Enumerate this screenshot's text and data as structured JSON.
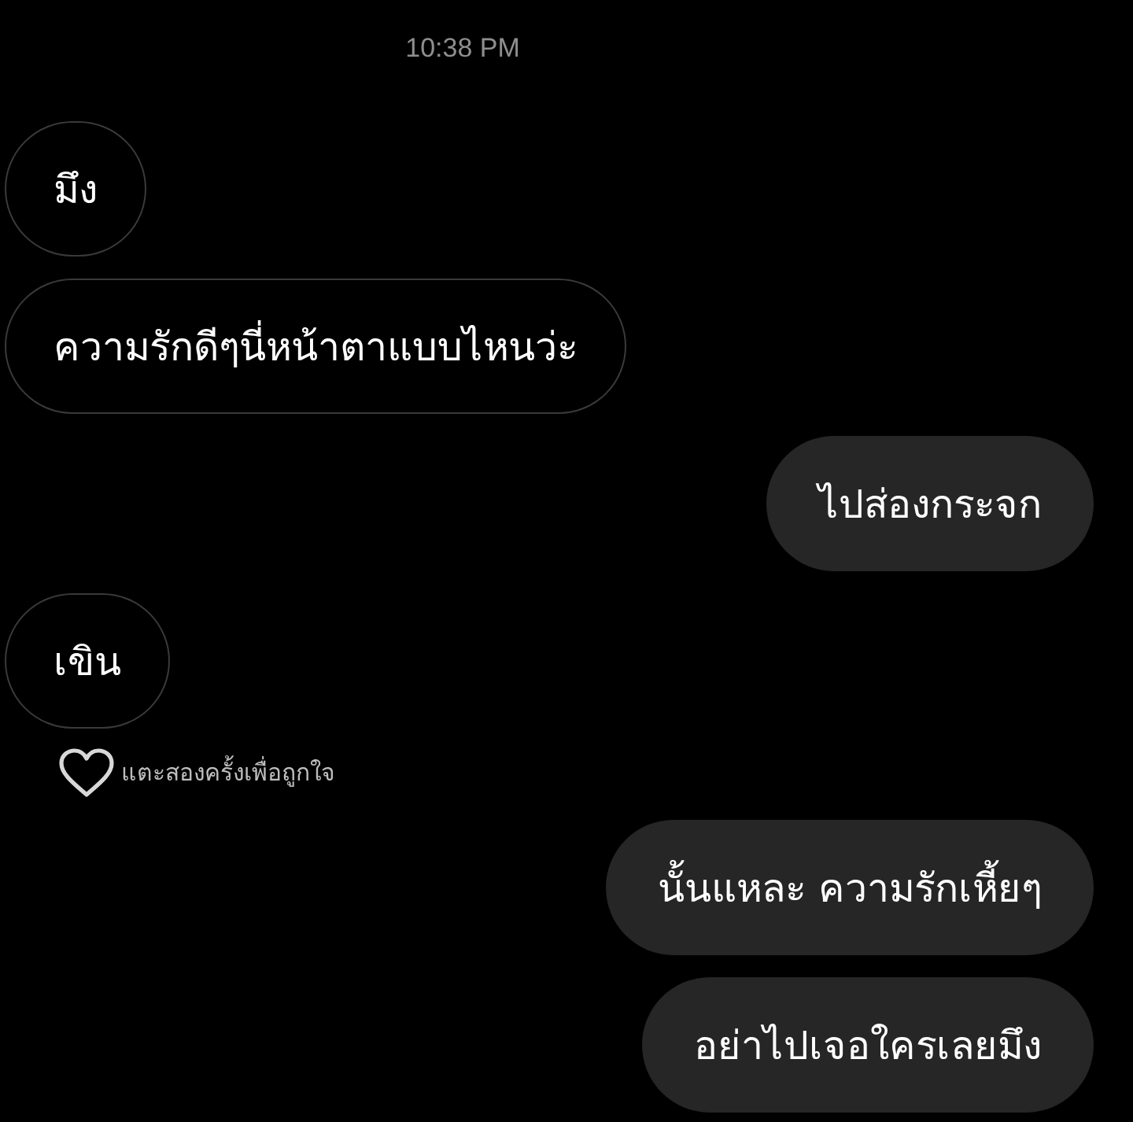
{
  "timestamp": "10:38 PM",
  "messages": [
    {
      "kind": "received",
      "text": "มึง"
    },
    {
      "kind": "received",
      "text": "ความรักดีๆนี่หน้าตาแบบไหนว่ะ"
    },
    {
      "kind": "sent",
      "text": "ไปส่องกระจก"
    },
    {
      "kind": "received",
      "text": "เขิน"
    },
    {
      "kind": "like_hint",
      "text": "แตะสองครั้งเพื่อถูกใจ"
    },
    {
      "kind": "sent",
      "text": "นั้นแหละ ความรักเหี้ยๆ"
    },
    {
      "kind": "sent",
      "text": "อย่าไปเจอใครเลยมึง"
    }
  ]
}
